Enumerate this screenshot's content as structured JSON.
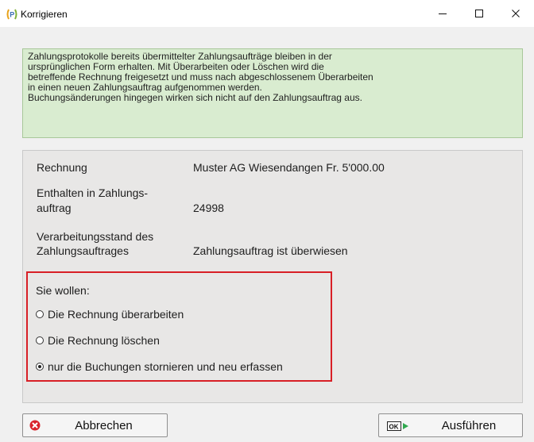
{
  "window": {
    "title": "Korrigieren",
    "app_icon": "app-logo-icon",
    "controls": {
      "minimize": "minimize-icon",
      "maximize": "maximize-icon",
      "close": "close-icon"
    }
  },
  "info_box": {
    "lines": [
      "Zahlungsprotokolle bereits übermittelter Zahlungsaufträge bleiben in der",
      "ursprünglichen Form erhalten. Mit Überarbeiten oder Löschen wird die",
      "betreffende Rechnung freigesetzt und muss nach abgeschlossenem Überarbeiten",
      "in einen neuen Zahlungsauftrag aufgenommen werden.",
      "Buchungsänderungen hingegen wirken sich nicht auf den Zahlungsauftrag aus."
    ],
    "background": "#d9ecd0"
  },
  "details": {
    "rechnung_label": "Rechnung",
    "rechnung_value": "Muster AG Wiesendangen Fr.  5'000.00",
    "zahlungsauftrag_label_1": "Enthalten in Zahlungs-",
    "zahlungsauftrag_label_2": "auftrag",
    "zahlungsauftrag_value": "24998",
    "stand_label_1": "Verarbeitungsstand des",
    "stand_label_2": "Zahlungsauftrages",
    "stand_value": "Zahlungsauftrag ist überwiesen"
  },
  "choice": {
    "title": "Sie wollen:",
    "options": [
      {
        "label": "Die Rechnung überarbeiten",
        "selected": false
      },
      {
        "label": "Die Rechnung löschen",
        "selected": false
      },
      {
        "label": "nur die Buchungen stornieren und neu erfassen",
        "selected": true
      }
    ],
    "highlight_color": "#d81f26"
  },
  "buttons": {
    "cancel_label": "Abbrechen",
    "cancel_icon": "cancel-icon",
    "execute_label": "Ausführen",
    "execute_icon": "ok-icon",
    "execute_icon_text": "OK"
  }
}
